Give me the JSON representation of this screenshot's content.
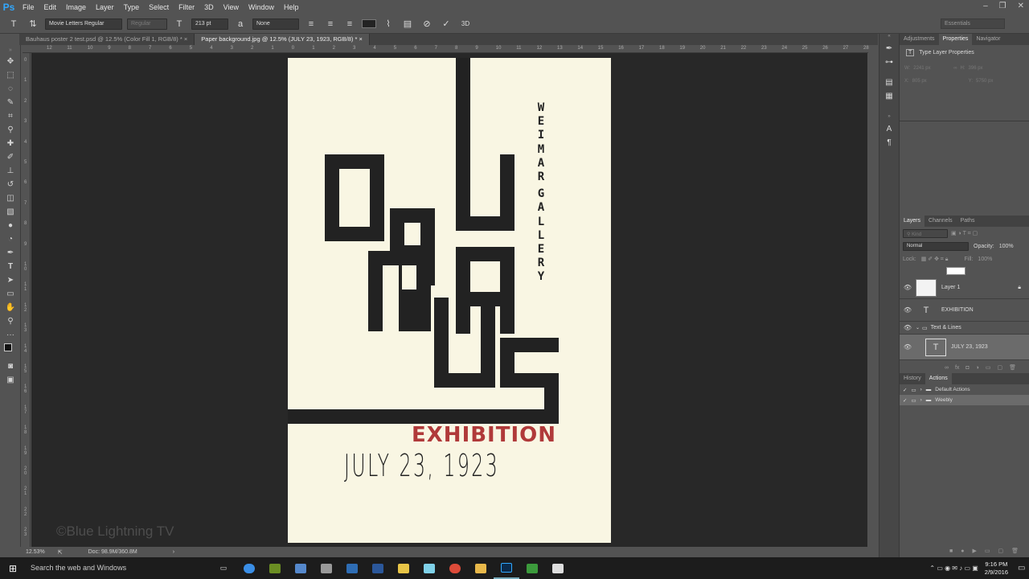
{
  "app": {
    "logo": "Ps",
    "menu": [
      "File",
      "Edit",
      "Image",
      "Layer",
      "Type",
      "Select",
      "Filter",
      "3D",
      "View",
      "Window",
      "Help"
    ],
    "window_controls": [
      "–",
      "❐",
      "✕"
    ]
  },
  "options_bar": {
    "font_family": "Movie Letters Regular",
    "font_style": "Regular",
    "font_size": "213 pt",
    "anti_alias": "None",
    "workspace": "Essentials",
    "color": "#232323"
  },
  "tabs": [
    {
      "label": "Bauhaus poster 2 test.psd @ 12.5% (Color Fill 1, RGB/8) *",
      "active": false
    },
    {
      "label": "Paper background.jpg @ 12.5% (JULY 23, 1923, RGB/8) *",
      "active": true
    }
  ],
  "ruler_top": [
    "12",
    "11",
    "10",
    "9",
    "8",
    "7",
    "6",
    "5",
    "4",
    "3",
    "2",
    "1",
    "0",
    "1",
    "2",
    "3",
    "4",
    "5",
    "6",
    "7",
    "8",
    "9",
    "10",
    "11",
    "12",
    "13",
    "14",
    "15",
    "16",
    "17",
    "18",
    "19",
    "20",
    "21",
    "22",
    "23",
    "24",
    "25",
    "26",
    "27",
    "28"
  ],
  "ruler_left": [
    "0",
    "1",
    "2",
    "3",
    "4",
    "5",
    "6",
    "7",
    "8",
    "9",
    "10",
    "11",
    "12",
    "13",
    "14",
    "15",
    "16",
    "17",
    "18",
    "19",
    "20",
    "21",
    "22",
    "23"
  ],
  "poster": {
    "vertical_text": [
      "W",
      "E",
      "I",
      "M",
      "A",
      "R",
      "G",
      "A",
      "L",
      "L",
      "E",
      "R",
      "Y"
    ],
    "exhibition": "EXHIBITION",
    "date": "JULY 23, 1923",
    "accent": "#b03a3a",
    "ink": "#222222",
    "paper": "#f9f6e3"
  },
  "status": {
    "zoom": "12.53%",
    "doc": "Doc: 98.9M/360.8M"
  },
  "right_panel": {
    "top_tabs": [
      "Adjustments",
      "Properties",
      "Navigator"
    ],
    "properties_title": "Type Layer Properties",
    "props": {
      "w_label": "W:",
      "w_val": "2241 px",
      "h_label": "H:",
      "h_val": "396 px",
      "x_label": "X:",
      "x_val": "805 px",
      "y_label": "Y:",
      "y_val": "5750 px"
    },
    "layer_tabs": [
      "Layers",
      "Channels",
      "Paths"
    ],
    "kind": "Kind",
    "blend_mode": "Normal",
    "opacity_label": "Opacity:",
    "opacity": "100%",
    "lock_label": "Lock:",
    "fill_label": "Fill:",
    "fill": "100%",
    "layers": [
      {
        "name": "Layer 1",
        "type": "image",
        "locked": true
      },
      {
        "name": "EXHIBITION",
        "type": "text"
      },
      {
        "name": "Text & Lines",
        "type": "group"
      },
      {
        "name": "JULY 23, 1923",
        "type": "text",
        "selected": true
      }
    ],
    "bottom_tabs": [
      "History",
      "Actions"
    ],
    "actions": [
      {
        "name": "Default Actions"
      },
      {
        "name": "Weebly",
        "selected": true
      }
    ]
  },
  "credit": "©Blue Lightning TV",
  "taskbar": {
    "search_placeholder": "Search the web and Windows",
    "time": "9:16 PM",
    "date": "2/9/2016"
  }
}
